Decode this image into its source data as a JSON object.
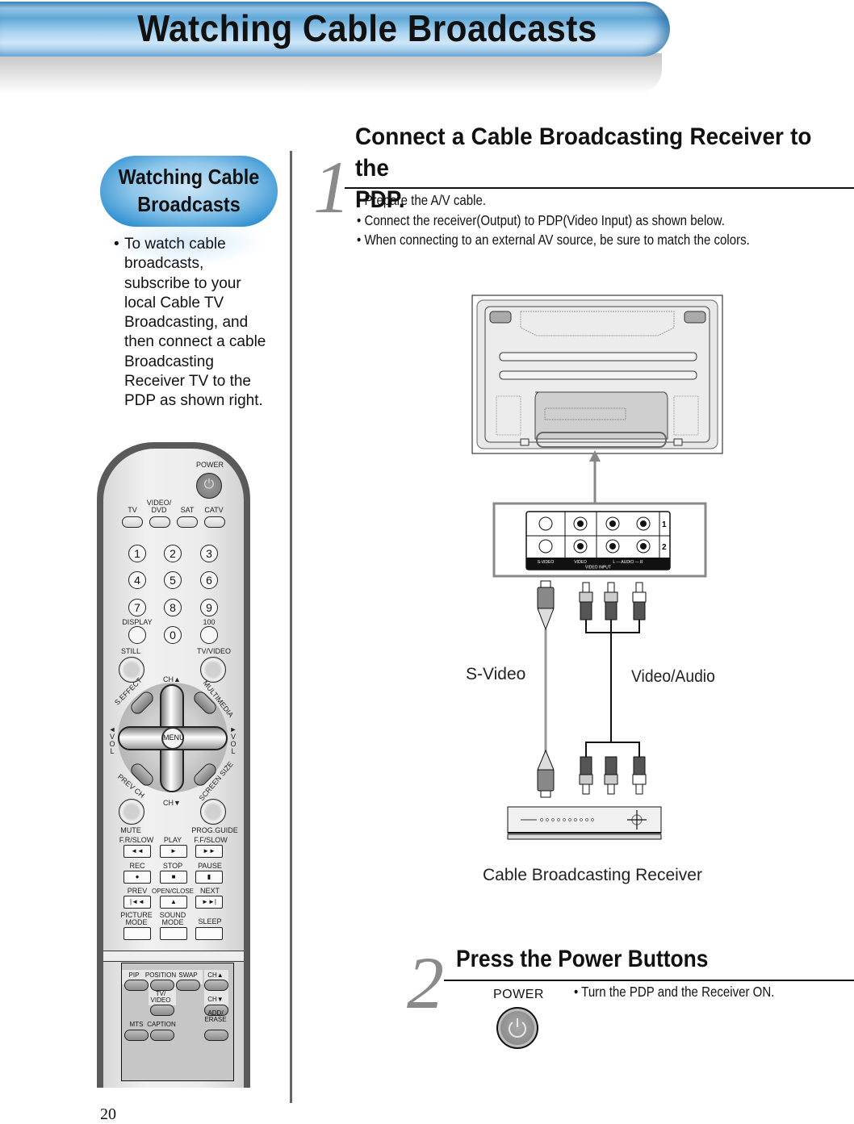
{
  "header": {
    "title": "Watching Cable Broadcasts"
  },
  "sidebar": {
    "pill_title_line1": "Watching Cable",
    "pill_title_line2": "Broadcasts",
    "bullet": "•",
    "text_lines": [
      "To watch cable",
      "broadcasts,",
      "subscribe to your",
      "local Cable TV",
      "Broadcasting, and",
      "then connect a cable",
      "Broadcasting",
      "Receiver TV to the",
      "PDP as shown right."
    ]
  },
  "step1": {
    "number": "1",
    "title_line1": "Connect a Cable Broadcasting Receiver to the",
    "title_line2": "PDP.",
    "bullets": [
      "• Prepare the A/V cable.",
      "• Connect the receiver(Output) to PDP(Video Input) as shown below.",
      "• When connecting to an external AV source, be sure to match the colors."
    ]
  },
  "diagram": {
    "input_panel": {
      "row_labels": [
        "1",
        "2"
      ],
      "column_labels": [
        "S-VIDEO",
        "VIDEO",
        "L — AUDIO — R"
      ],
      "panel_label": "VIDEO INPUT"
    },
    "svideo_label": "S-Video",
    "video_audio_label": "Video/Audio",
    "receiver_label": "Cable Broadcasting Receiver"
  },
  "step2": {
    "number": "2",
    "title": "Press the Power Buttons",
    "power_label": "POWER",
    "bullet": "• Turn the PDP and the Receiver ON."
  },
  "page_number": "20",
  "remote": {
    "power": "POWER",
    "modes": [
      "TV",
      "VIDEO/\nDVD",
      "SAT",
      "CATV"
    ],
    "digits": [
      "1",
      "2",
      "3",
      "4",
      "5",
      "6",
      "7",
      "8",
      "9",
      "0"
    ],
    "display": "DISPLAY",
    "hundred": "100",
    "still": "STILL",
    "tv_video": "TV/VIDEO",
    "ch_up": "CH▲",
    "ch_down": "CH▼",
    "s_effect": "S.EFFECT",
    "multimedia": "MULTIMEDIA",
    "prev_ch": "PREV CH",
    "screen_size": "SCREEN SIZE",
    "vol_left": "◄\nV\nO\nL",
    "vol_right": "►\nV\nO\nL",
    "menu": "MENU",
    "mute": "MUTE",
    "prog_guide": "PROG.GUIDE",
    "transport_labels": [
      "F.R/SLOW",
      "PLAY",
      "F.F/SLOW",
      "REC",
      "STOP",
      "PAUSE",
      "PREV",
      "OPEN/CLOSE",
      "NEXT"
    ],
    "transport_glyphs": [
      "◄◄",
      "►",
      "►►",
      "●",
      "■",
      "▮",
      "|◄◄",
      "▲",
      "►►|"
    ],
    "picture_mode": "PICTURE\nMODE",
    "sound_mode": "SOUND\nMODE",
    "sleep": "SLEEP",
    "panel": {
      "pip": "PIP",
      "position": "POSITION",
      "swap": "SWAP",
      "ch_up": "CH▲",
      "tv_video": "TV/\nVIDEO",
      "ch_down": "CH▼",
      "mts": "MTS",
      "caption": "CAPTION",
      "add_erase": "ADD/\nERASE"
    }
  }
}
